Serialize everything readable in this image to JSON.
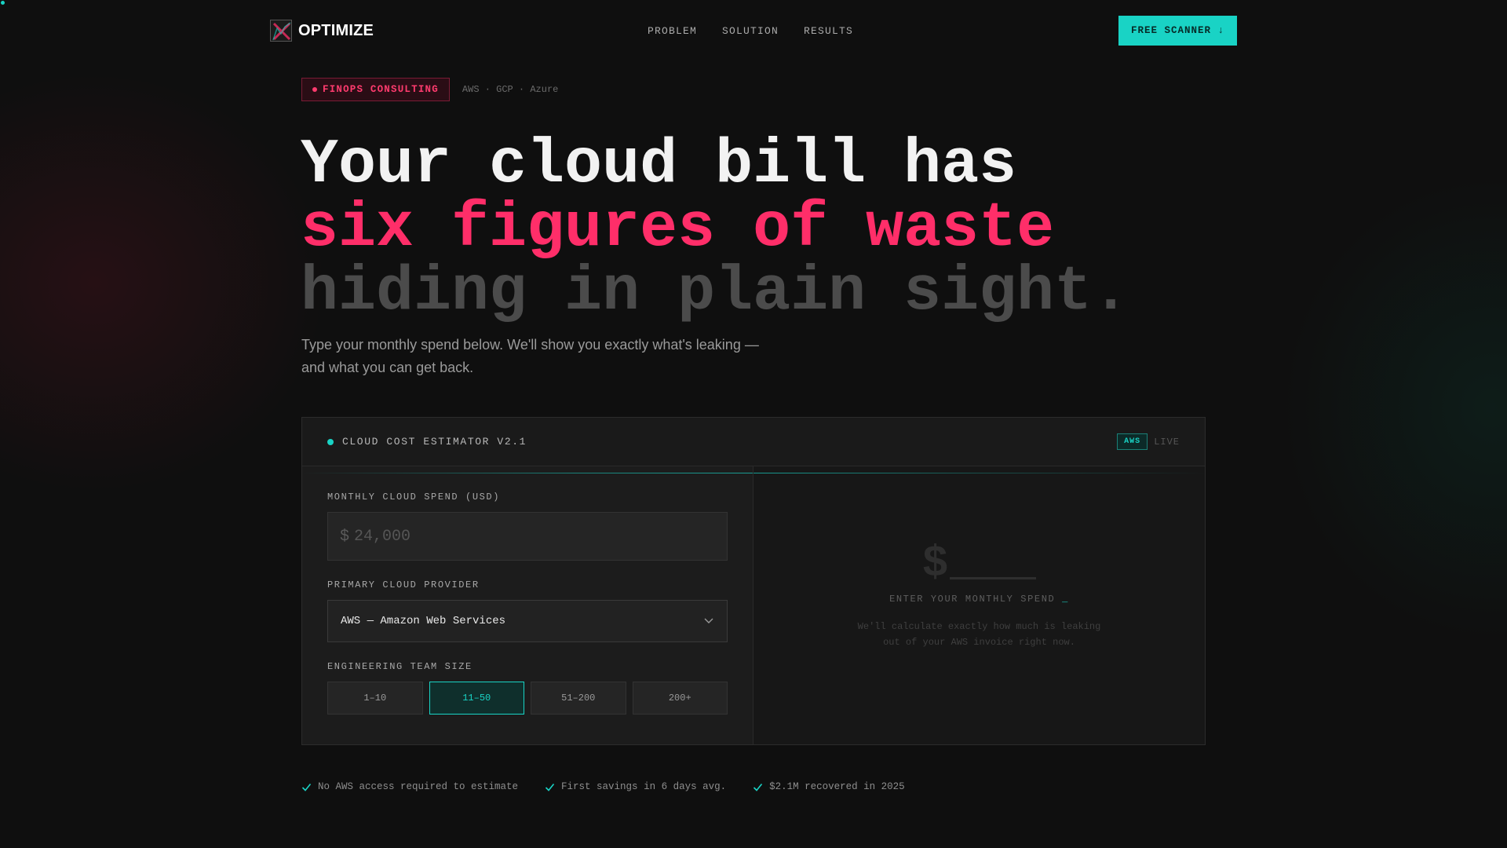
{
  "nav": {
    "brand": "OPTIMIZE",
    "links": [
      "PROBLEM",
      "SOLUTION",
      "RESULTS"
    ],
    "cta": "FREE SCANNER ↓"
  },
  "hero": {
    "badge": "FINOPS CONSULTING",
    "providers": "AWS · GCP · Azure",
    "line1": "Your cloud bill has",
    "line2": "six figures of waste",
    "line3": "hiding in plain sight.",
    "subtitle": "Type your monthly spend below. We'll show you exactly what's leaking — and what you can get back."
  },
  "estimator": {
    "title": "CLOUD COST ESTIMATOR V2.1",
    "tag": "AWS",
    "status": "LIVE",
    "spend_label": "MONTHLY CLOUD SPEND (USD)",
    "currency": "$",
    "spend_placeholder": "24,000",
    "spend_value": "",
    "provider_label": "PRIMARY CLOUD PROVIDER",
    "provider_value": "AWS — Amazon Web Services",
    "team_label": "ENGINEERING TEAM SIZE",
    "team_options": [
      "1–10",
      "11–50",
      "51–200",
      "200+"
    ],
    "team_selected": "11–50",
    "result_symbol": "$",
    "result_title": "ENTER YOUR MONTHLY SPEND",
    "result_caret": "_",
    "result_desc": "We'll calculate exactly how much is leaking out of your AWS invoice right now."
  },
  "trust": [
    "No AWS access required to estimate",
    "First savings in 6 days avg.",
    "$2.1M recovered in 2025"
  ],
  "colors": {
    "accent": "#19d3c5",
    "danger": "#ff2e69",
    "background": "#0f0f0f"
  }
}
